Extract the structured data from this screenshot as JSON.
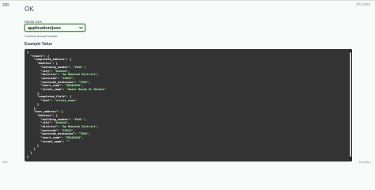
{
  "response": {
    "status_code": "200",
    "description": "OK",
    "links_text": "No links",
    "media_type_label": "Media type",
    "media_type_value": "application/json",
    "controls_note": "Controls Accept header.",
    "example_tab": "Example Value",
    "code_lines": [
      [
        "",
        "{"
      ],
      [
        "",
        "  \"result\": {"
      ],
      [
        "",
        "    \"completed_address\": {"
      ],
      [
        "",
        "      \"Address\": {"
      ],
      [
        "",
        "        \"building_number\": ",
        "\"6548 \"",
        ","
      ],
      [
        "",
        "        \"city\": ",
        "\"Ashbah\"",
        ","
      ],
      [
        "",
        "        \"district\": ",
        "\"Am Rabaieh District\"",
        ","
      ],
      [
        "",
        "        \"postcode\": ",
        "\"23615\"",
        ","
      ],
      [
        "",
        "        \"postcode_extension\": ",
        "\"7368\"",
        ","
      ],
      [
        "",
        "        \"short_code\": ",
        "\"JESA6548\"",
        ","
      ],
      [
        "",
        "        \"street_name\": ",
        "\"Abdul Munim Al Ghiani\"",
        ""
      ],
      [
        "",
        "      },"
      ],
      [
        "",
        "      \"completed_field\": {"
      ],
      [
        "",
        "        \"text\": ",
        "\"street_name\"",
        ""
      ],
      [
        "",
        "      }"
      ],
      [
        "",
        "    },"
      ],
      [
        "",
        "    \"user_address\": {"
      ],
      [
        "",
        "      \"Address\": {"
      ],
      [
        "",
        "        \"building_number\": ",
        "\"6548 \"",
        ","
      ],
      [
        "",
        "        \"city\": ",
        "\"Ashbah\"",
        ","
      ],
      [
        "",
        "        \"district\": ",
        "\"Am Rabaieh District\"",
        ","
      ],
      [
        "",
        "        \"postcode\": ",
        "\"23615\"",
        ","
      ],
      [
        "",
        "        \"postcode_extension\": ",
        "\"7368\"",
        ","
      ],
      [
        "",
        "        \"short_code\": ",
        "\"JESA6548\"",
        ","
      ],
      [
        "",
        "        \"street_name\": ",
        "\"\"",
        ""
      ],
      [
        "",
        "      }"
      ],
      [
        "",
        "    }"
      ],
      [
        "",
        "  }"
      ],
      [
        "",
        "}"
      ]
    ]
  },
  "footer": {
    "left": "400",
    "right": "No links"
  },
  "colors": {
    "code_bg": "#333333",
    "string": "#a2fca2",
    "select_border": "#3a9a3a"
  }
}
